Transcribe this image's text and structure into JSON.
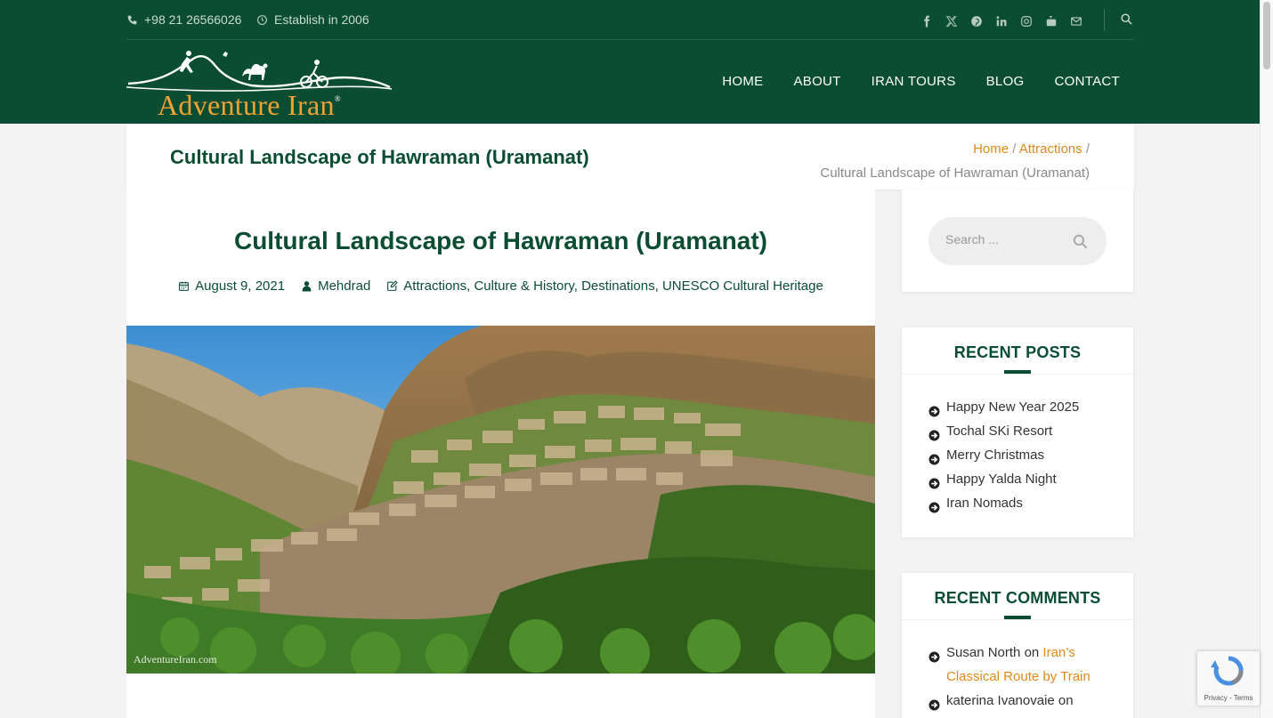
{
  "topbar": {
    "phone": "+98 21 26566026",
    "established": "Establish in 2006",
    "social_icons": [
      "facebook-icon",
      "x-twitter-icon",
      "pinterest-icon",
      "linkedin-icon",
      "instagram-icon",
      "youtube-icon",
      "envelope-icon"
    ]
  },
  "logo": {
    "text": "Adventure Iran",
    "mark": "®"
  },
  "nav": {
    "items": [
      "HOME",
      "ABOUT",
      "IRAN TOURS",
      "BLOG",
      "CONTACT"
    ]
  },
  "titlebar": {
    "title": "Cultural Landscape of Hawraman (Uramanat)",
    "breadcrumb": {
      "home": "Home",
      "sep": "/",
      "section": "Attractions",
      "current": "Cultural Landscape of Hawraman (Uramanat)"
    }
  },
  "article": {
    "title": "Cultural Landscape of Hawraman (Uramanat)",
    "date": "August 9, 2021",
    "author": "Mehdrad",
    "categories": "Attractions, Culture & History, Destinations, UNESCO Cultural Heritage",
    "image_watermark": "AdventureIran.com"
  },
  "sidebar": {
    "search_placeholder": "Search ...",
    "recent_posts": {
      "title": "RECENT POSTS",
      "items": [
        "Happy New Year 2025",
        "Tochal SKi Resort",
        "Merry Christmas",
        "Happy Yalda Night",
        "Iran Nomads"
      ]
    },
    "recent_comments": {
      "title": "RECENT COMMENTS",
      "items": [
        {
          "author": "Susan North",
          "on": "on",
          "post_line1": "Iran’s",
          "post_line2": "Classical Route by Train"
        },
        {
          "author": "katerina Ivanovaie",
          "on": "on"
        }
      ]
    }
  },
  "recaptcha": {
    "text": "Privacy - Terms"
  },
  "colors": {
    "brand_green": "#0a4d32",
    "accent_orange": "#e08a1e"
  }
}
